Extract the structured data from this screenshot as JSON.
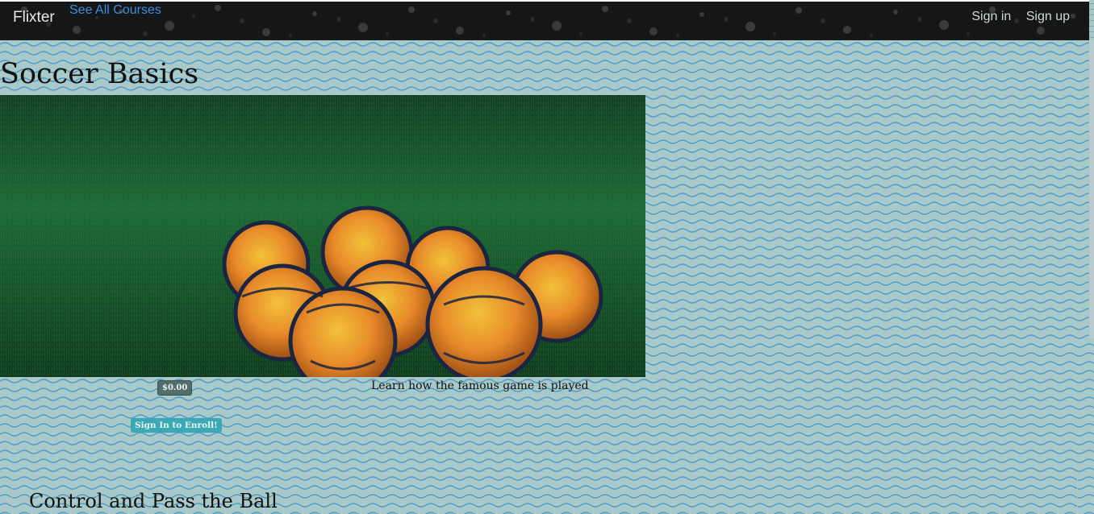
{
  "navbar": {
    "brand": "Flixter",
    "see_all": "See All Courses",
    "sign_in": "Sign in",
    "sign_up": "Sign up"
  },
  "course": {
    "title": "Soccer Basics",
    "image_alt": "soccer balls on grass",
    "price": "$0.00",
    "description": "Learn how the famous game is played",
    "enroll_label": "Sign In to Enroll!"
  },
  "sections": [
    {
      "title": "Control and Pass the Ball"
    }
  ],
  "colors": {
    "navbar_bg": "#151515",
    "link": "#3b8fe0",
    "background": "#a7c6c6",
    "enroll_button": "#3aa9b3",
    "price_badge": "#536e6a"
  }
}
